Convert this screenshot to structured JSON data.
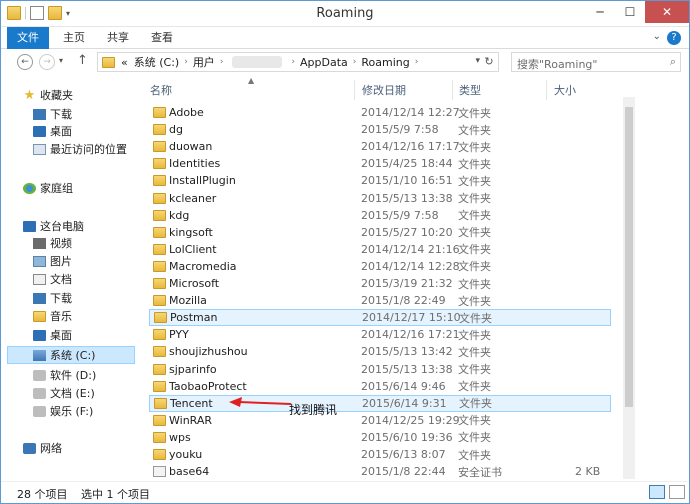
{
  "window": {
    "title": "Roaming",
    "controls": {
      "minimize": "─",
      "maximize": "☐",
      "close": "✕"
    }
  },
  "ribbon": {
    "tabs": [
      "文件",
      "主页",
      "共享",
      "查看"
    ],
    "help": "?"
  },
  "navigation": {
    "back": "←",
    "forward": "→",
    "up": "↑",
    "breadcrumb": [
      "«",
      "系统 (C:)",
      "用户",
      "AppData",
      "Roaming"
    ],
    "search_placeholder": "搜索\"Roaming\""
  },
  "sidebar": {
    "items": [
      {
        "label": "收藏夹",
        "icon": "star-icon",
        "selected": false
      },
      {
        "label": "下载",
        "icon": "download-icon",
        "selected": false
      },
      {
        "label": "桌面",
        "icon": "desktop-icon",
        "selected": false
      },
      {
        "label": "最近访问的位置",
        "icon": "recent-icon",
        "selected": false
      },
      {
        "label": "家庭组",
        "icon": "homegroup-icon",
        "selected": false
      },
      {
        "label": "这台电脑",
        "icon": "computer-icon",
        "selected": false
      },
      {
        "label": "视频",
        "icon": "video-icon",
        "selected": false
      },
      {
        "label": "图片",
        "icon": "picture-icon",
        "selected": false
      },
      {
        "label": "文档",
        "icon": "document-icon",
        "selected": false
      },
      {
        "label": "下载",
        "icon": "download-icon",
        "selected": false
      },
      {
        "label": "音乐",
        "icon": "music-icon",
        "selected": false
      },
      {
        "label": "桌面",
        "icon": "desktop-icon",
        "selected": false
      },
      {
        "label": "系统 (C:)",
        "icon": "system-drive-icon",
        "selected": true
      },
      {
        "label": "软件 (D:)",
        "icon": "drive-icon",
        "selected": false
      },
      {
        "label": "文档 (E:)",
        "icon": "drive-icon",
        "selected": false
      },
      {
        "label": "娱乐 (F:)",
        "icon": "drive-icon",
        "selected": false
      },
      {
        "label": "网络",
        "icon": "network-icon",
        "selected": false
      }
    ]
  },
  "file_list": {
    "columns": [
      "名称",
      "修改日期",
      "类型",
      "大小"
    ],
    "rows": [
      {
        "name": "Adobe",
        "date": "2014/12/14 12:27",
        "type": "文件夹",
        "size": ""
      },
      {
        "name": "dg",
        "date": "2015/5/9 7:58",
        "type": "文件夹",
        "size": ""
      },
      {
        "name": "duowan",
        "date": "2014/12/16 17:17",
        "type": "文件夹",
        "size": ""
      },
      {
        "name": "Identities",
        "date": "2015/4/25 18:44",
        "type": "文件夹",
        "size": ""
      },
      {
        "name": "InstallPlugin",
        "date": "2015/1/10 16:51",
        "type": "文件夹",
        "size": ""
      },
      {
        "name": "kcleaner",
        "date": "2015/5/13 13:38",
        "type": "文件夹",
        "size": ""
      },
      {
        "name": "kdg",
        "date": "2015/5/9 7:58",
        "type": "文件夹",
        "size": ""
      },
      {
        "name": "kingsoft",
        "date": "2015/5/27 10:20",
        "type": "文件夹",
        "size": ""
      },
      {
        "name": "LolClient",
        "date": "2014/12/14 21:16",
        "type": "文件夹",
        "size": ""
      },
      {
        "name": "Macromedia",
        "date": "2014/12/14 12:28",
        "type": "文件夹",
        "size": ""
      },
      {
        "name": "Microsoft",
        "date": "2015/3/19 21:32",
        "type": "文件夹",
        "size": ""
      },
      {
        "name": "Mozilla",
        "date": "2015/1/8 22:49",
        "type": "文件夹",
        "size": ""
      },
      {
        "name": "Postman",
        "date": "2014/12/17 15:10",
        "type": "文件夹",
        "size": "",
        "highlight": true
      },
      {
        "name": "PYY",
        "date": "2014/12/16 17:21",
        "type": "文件夹",
        "size": ""
      },
      {
        "name": "shoujizhushou",
        "date": "2015/5/13 13:42",
        "type": "文件夹",
        "size": ""
      },
      {
        "name": "sjparinfo",
        "date": "2015/5/13 13:38",
        "type": "文件夹",
        "size": ""
      },
      {
        "name": "TaobaoProtect",
        "date": "2015/6/14 9:46",
        "type": "文件夹",
        "size": ""
      },
      {
        "name": "Tencent",
        "date": "2015/6/14 9:31",
        "type": "文件夹",
        "size": "",
        "highlight": true
      },
      {
        "name": "WinRAR",
        "date": "2014/12/25 19:29",
        "type": "文件夹",
        "size": ""
      },
      {
        "name": "wps",
        "date": "2015/6/10 19:36",
        "type": "文件夹",
        "size": ""
      },
      {
        "name": "youku",
        "date": "2015/6/13 8:07",
        "type": "文件夹",
        "size": ""
      },
      {
        "name": "base64",
        "date": "2015/1/8 22:44",
        "type": "安全证书",
        "size": "2 KB",
        "file": true
      }
    ]
  },
  "annotation": {
    "text": "找到腾讯",
    "color": "#e02020"
  },
  "status": {
    "count": "28 个项目",
    "selected": "选中 1 个项目"
  }
}
